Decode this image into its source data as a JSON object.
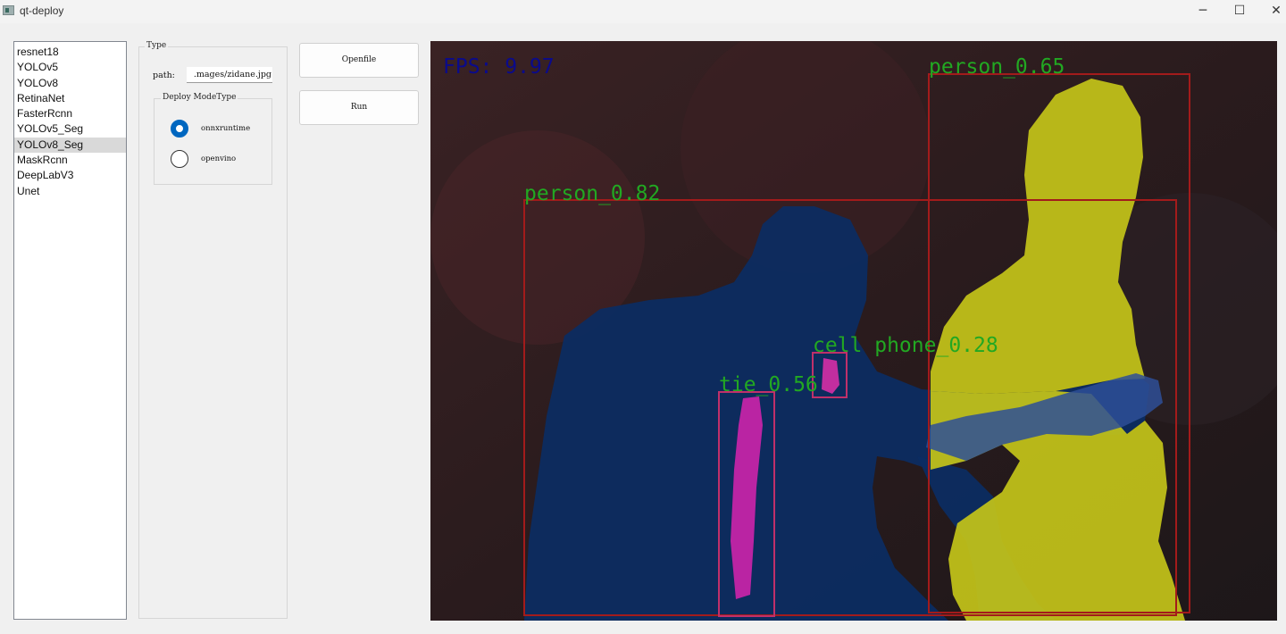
{
  "window": {
    "title": "qt-deploy",
    "minimize_glyph": "─",
    "maximize_glyph": "☐",
    "close_glyph": "✕"
  },
  "models": {
    "items": [
      "resnet18",
      "YOLOv5",
      "YOLOv8",
      "RetinaNet",
      "FasterRcnn",
      "YOLOv5_Seg",
      "YOLOv8_Seg",
      "MaskRcnn",
      "DeepLabV3",
      "Unet"
    ],
    "selected_index": 6
  },
  "settings": {
    "group_title": "Type",
    "path_label": "path:",
    "path_value": ".mages/zidane.jpg",
    "mode_group_title": "Deploy ModeType",
    "modes": [
      {
        "label": "onnxruntime",
        "checked": true
      },
      {
        "label": "openvino",
        "checked": false
      }
    ]
  },
  "actions": {
    "openfile_label": "Openfile",
    "run_label": "Run"
  },
  "result": {
    "fps_text": "FPS: 9.97",
    "detections": [
      {
        "label": "person_0.82",
        "class": "person",
        "score": 0.82
      },
      {
        "label": "person_0.65",
        "class": "person",
        "score": 0.65
      },
      {
        "label": "cell phone_0.28",
        "class": "cell phone",
        "score": 0.28
      },
      {
        "label": "tie_0.56",
        "class": "tie",
        "score": 0.56
      }
    ],
    "colors": {
      "person_left_mask": "#0b2c63",
      "person_right_mask": "#c4c419",
      "tie_mask": "#c424a6",
      "box": "#a31b1b",
      "label": "#22a822",
      "fps": "#0a0a8c"
    }
  }
}
